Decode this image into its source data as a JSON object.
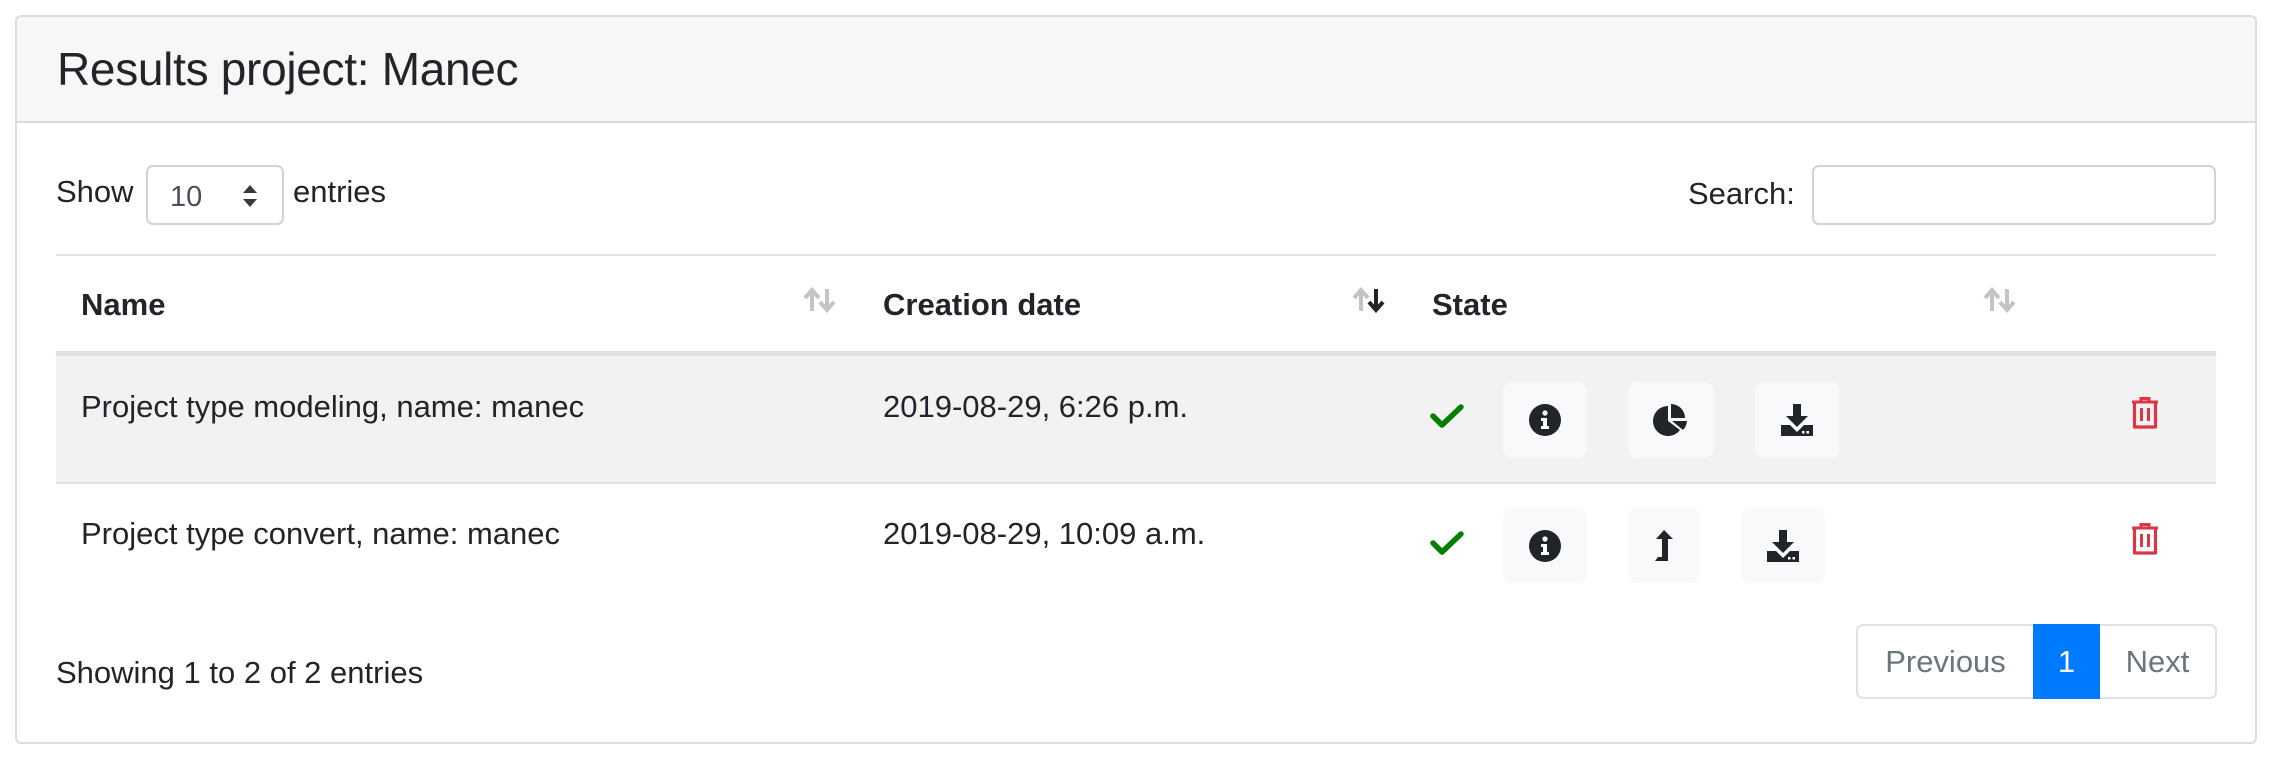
{
  "card": {
    "title": "Results project: Manec"
  },
  "length_control": {
    "show_label": "Show",
    "selected": "10",
    "entries_label": "entries"
  },
  "search": {
    "label": "Search:",
    "value": "",
    "placeholder": ""
  },
  "table": {
    "columns": [
      {
        "label": "Name",
        "sort": "unsorted"
      },
      {
        "label": "Creation date",
        "sort": "descending"
      },
      {
        "label": "State",
        "sort": "unsorted"
      }
    ],
    "rows": [
      {
        "name": "Project type modeling, name: manec",
        "creation_date": "2019-08-29, 6:26 p.m.",
        "state_icon": "check-icon",
        "actions": [
          "info-icon",
          "pie-chart-icon",
          "download-icon"
        ],
        "delete_icon": "trash-icon"
      },
      {
        "name": "Project type convert, name: manec",
        "creation_date": "2019-08-29, 10:09 a.m.",
        "state_icon": "check-icon",
        "actions": [
          "info-icon",
          "level-up-arrow-icon",
          "download-icon"
        ],
        "delete_icon": "trash-icon"
      }
    ]
  },
  "footer": {
    "info": "Showing 1 to 2 of 2 entries",
    "pagination": {
      "previous": "Previous",
      "current": "1",
      "next": "Next"
    }
  },
  "colors": {
    "success": "#008000",
    "danger": "#dc3545",
    "primary": "#007bff",
    "text": "#212529",
    "muted": "#6c757d"
  }
}
